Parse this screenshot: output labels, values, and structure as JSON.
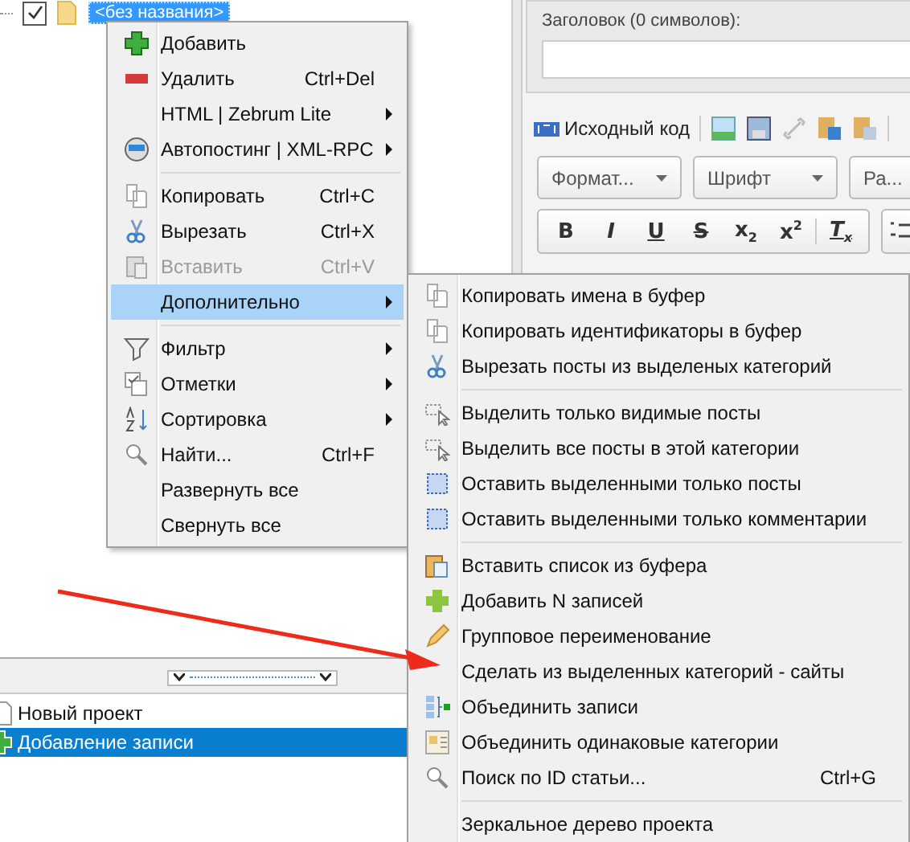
{
  "tree": {
    "label": "<без названия>",
    "checked": true,
    "selected": true
  },
  "editor": {
    "title_label": "Заголовок (0 символов):",
    "source_button": "Исходный код",
    "dropdowns": [
      "Формат...",
      "Шрифт",
      "Ра..."
    ],
    "format_buttons": [
      {
        "kind": "bold",
        "label": "B"
      },
      {
        "kind": "italic",
        "label": "I"
      },
      {
        "kind": "underline",
        "label": "U"
      },
      {
        "kind": "strike",
        "label": "S"
      },
      {
        "kind": "plain",
        "label": "x$_{2}$"
      },
      {
        "kind": "plain",
        "label": "x$^{2}$"
      },
      {
        "kind": "clear",
        "label": "T$_{x}$"
      }
    ]
  },
  "projects": {
    "items": [
      {
        "label": "Новый проект",
        "selected": false
      },
      {
        "label": "Добавление записи",
        "selected": true
      }
    ]
  },
  "context_menu": {
    "items": [
      {
        "kind": "item",
        "label": "Добавить",
        "submenu": false,
        "disabled": false,
        "selected": false
      },
      {
        "kind": "item",
        "label": "Удалить",
        "shortcut": "Ctrl+Del",
        "submenu": false,
        "disabled": false,
        "selected": false
      },
      {
        "kind": "item",
        "label": "HTML | Zebrum Lite",
        "submenu": true,
        "disabled": false,
        "selected": false
      },
      {
        "kind": "item",
        "label": "Автопостинг | XML-RPC",
        "submenu": true,
        "disabled": false,
        "selected": false
      },
      {
        "kind": "separator"
      },
      {
        "kind": "item",
        "label": "Копировать",
        "shortcut": "Ctrl+C",
        "submenu": false,
        "disabled": false,
        "selected": false
      },
      {
        "kind": "item",
        "label": "Вырезать",
        "shortcut": "Ctrl+X",
        "submenu": false,
        "disabled": false,
        "selected": false
      },
      {
        "kind": "item",
        "label": "Вставить",
        "shortcut": "Ctrl+V",
        "submenu": false,
        "disabled": true,
        "selected": false
      },
      {
        "kind": "item",
        "label": "Дополнительно",
        "submenu": true,
        "disabled": false,
        "selected": true
      },
      {
        "kind": "separator"
      },
      {
        "kind": "item",
        "label": "Фильтр",
        "submenu": true,
        "disabled": false,
        "selected": false
      },
      {
        "kind": "item",
        "label": "Отметки",
        "submenu": true,
        "disabled": false,
        "selected": false
      },
      {
        "kind": "item",
        "label": "Сортировка",
        "submenu": true,
        "disabled": false,
        "selected": false
      },
      {
        "kind": "item",
        "label": "Найти...",
        "shortcut": "Ctrl+F",
        "submenu": false,
        "disabled": false,
        "selected": false
      },
      {
        "kind": "item",
        "label": "Развернуть все",
        "submenu": false,
        "disabled": false,
        "selected": false
      },
      {
        "kind": "item",
        "label": "Свернуть все",
        "submenu": false,
        "disabled": false,
        "selected": false
      }
    ]
  },
  "submenu": {
    "items": [
      {
        "kind": "item",
        "label": "Копировать имена в буфер",
        "disabled": false,
        "selected": false
      },
      {
        "kind": "item",
        "label": "Копировать идентификаторы в буфер",
        "disabled": false,
        "selected": false
      },
      {
        "kind": "item",
        "label": "Вырезать посты из выделеных категорий",
        "disabled": false,
        "selected": false
      },
      {
        "kind": "separator"
      },
      {
        "kind": "item",
        "label": "Выделить только видимые посты",
        "disabled": false,
        "selected": false
      },
      {
        "kind": "item",
        "label": "Выделить все посты в этой категории",
        "disabled": false,
        "selected": false
      },
      {
        "kind": "item",
        "label": "Оставить выделенными только посты",
        "disabled": false,
        "selected": false
      },
      {
        "kind": "item",
        "label": "Оставить выделенными только комментарии",
        "disabled": false,
        "selected": false
      },
      {
        "kind": "separator"
      },
      {
        "kind": "item",
        "label": "Вставить список из буфера",
        "disabled": false,
        "selected": false
      },
      {
        "kind": "item",
        "label": "Добавить N записей",
        "disabled": false,
        "selected": false
      },
      {
        "kind": "item",
        "label": "Групповое переименование",
        "disabled": false,
        "selected": false
      },
      {
        "kind": "item",
        "label": "Сделать из выделенных категорий - сайты",
        "disabled": false,
        "selected": false
      },
      {
        "kind": "item",
        "label": "Объединить записи",
        "disabled": false,
        "selected": false
      },
      {
        "kind": "item",
        "label": "Объединить одинаковые категории",
        "disabled": false,
        "selected": false
      },
      {
        "kind": "item",
        "label": "Поиск по ID статьи...",
        "shortcut": "Ctrl+G",
        "disabled": false,
        "selected": false
      },
      {
        "kind": "separator"
      },
      {
        "kind": "item",
        "label": "Зеркальное дерево проекта",
        "disabled": false,
        "selected": false
      }
    ]
  }
}
